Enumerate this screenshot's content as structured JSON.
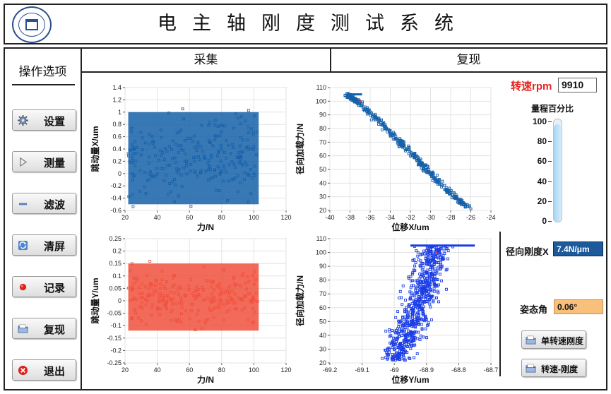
{
  "app": {
    "title": "电主轴刚度测试系统"
  },
  "sidebar": {
    "title": "操作选项",
    "items": [
      {
        "label": "设置",
        "icon": "gear-icon"
      },
      {
        "label": "测量",
        "icon": "play-icon"
      },
      {
        "label": "滤波",
        "icon": "minus-icon"
      },
      {
        "label": "清屏",
        "icon": "refresh-icon"
      },
      {
        "label": "记录",
        "icon": "record-icon"
      },
      {
        "label": "复现",
        "icon": "folder-icon"
      },
      {
        "label": "退出",
        "icon": "close-icon"
      }
    ]
  },
  "tabs": [
    {
      "label": "采集"
    },
    {
      "label": "复现"
    }
  ],
  "right_panel": {
    "rpm_label": "转速rpm",
    "rpm_value": "9910",
    "range_label": "量程百分比",
    "range_percent": 95,
    "gauge_ticks": [
      "100",
      "80",
      "60",
      "40",
      "20",
      "0"
    ],
    "stiffness_x_label": "径向刚度X",
    "stiffness_x_value": "7.4N/μm",
    "pose_label": "姿态角",
    "pose_value": "0.06°",
    "btn_single_label": "单转速刚度",
    "btn_speed_label": "转速-刚度"
  },
  "colors": {
    "blue_series": "#1560a8",
    "red_series": "#f0503c",
    "scatter_blue": "#1a3ce6",
    "accent_red": "#e8231e"
  },
  "chart_data": [
    {
      "type": "scatter",
      "xlabel": "力/N",
      "ylabel": "跳动量X/um",
      "xlim": [
        20,
        120
      ],
      "ylim": [
        -0.6,
        1.4
      ],
      "xticks": [
        "20",
        "40",
        "60",
        "80",
        "100",
        "120"
      ],
      "yticks": [
        "-0.6",
        "-0.4",
        "-0.2",
        "0",
        "0.2",
        "0.4",
        "0.6",
        "0.8",
        "1",
        "1.2",
        "1.4"
      ],
      "grid": true,
      "series": [
        {
          "color": "#1560a8",
          "x_range": [
            22,
            103
          ],
          "y_range": [
            -0.5,
            1.0
          ]
        }
      ]
    },
    {
      "type": "scatter",
      "xlabel": "位移X/um",
      "ylabel": "径向加载力/N",
      "xlim": [
        -40,
        -24
      ],
      "ylim": [
        20,
        110
      ],
      "xticks": [
        "-40",
        "-38",
        "-36",
        "-34",
        "-32",
        "-30",
        "-28",
        "-26",
        "-24"
      ],
      "yticks": [
        "20",
        "30",
        "40",
        "50",
        "60",
        "70",
        "80",
        "90",
        "100",
        "110"
      ],
      "grid": true,
      "series": [
        {
          "color": "#1560a8",
          "points": [
            [
              -38.3,
              105
            ],
            [
              -37.0,
              98
            ],
            [
              -34.0,
              77
            ],
            [
              -31.0,
              55
            ],
            [
              -28.5,
              36
            ],
            [
              -26.3,
              22
            ]
          ]
        }
      ]
    },
    {
      "type": "scatter",
      "xlabel": "力/N",
      "ylabel": "跳动量Y/um",
      "xlim": [
        20,
        120
      ],
      "ylim": [
        -0.25,
        0.25
      ],
      "xticks": [
        "20",
        "40",
        "60",
        "80",
        "100",
        "120"
      ],
      "yticks": [
        "-0.25",
        "-0.2",
        "-0.15",
        "-0.1",
        "-0.05",
        "0",
        "0.05",
        "0.1",
        "0.15",
        "0.2",
        "0.25"
      ],
      "grid": true,
      "series": [
        {
          "color": "#f0503c",
          "x_range": [
            22,
            103
          ],
          "y_range": [
            -0.12,
            0.15
          ]
        }
      ]
    },
    {
      "type": "scatter",
      "xlabel": "位移Y/um",
      "ylabel": "径向加载力/N",
      "xlim": [
        -69.2,
        -68.7
      ],
      "ylim": [
        20,
        110
      ],
      "xticks": [
        "-69.2",
        "-69.1",
        "-69",
        "-68.9",
        "-68.8",
        "-68.7"
      ],
      "yticks": [
        "20",
        "30",
        "40",
        "50",
        "60",
        "70",
        "80",
        "90",
        "100",
        "110"
      ],
      "grid": true,
      "series": [
        {
          "color": "#1a3ce6",
          "center": [
            [
              -69.0,
              22
            ],
            [
              -68.92,
              60
            ],
            [
              -68.87,
              105
            ]
          ]
        }
      ]
    }
  ]
}
